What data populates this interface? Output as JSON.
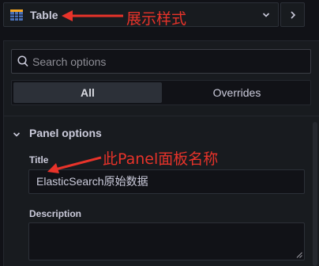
{
  "viz_picker": {
    "name": "Table",
    "icon": "table-icon"
  },
  "search": {
    "placeholder": "Search options",
    "value": ""
  },
  "tabs": [
    {
      "label": "All",
      "active": true
    },
    {
      "label": "Overrides",
      "active": false
    }
  ],
  "panel_options": {
    "title": "Panel options",
    "expanded": true,
    "fields": {
      "title_label": "Title",
      "title_value": "ElasticSearch原始数据",
      "description_label": "Description",
      "description_value": ""
    }
  },
  "annotations": {
    "viz_note": "展示样式",
    "title_note": "此Panel面板名称"
  },
  "colors": {
    "annotation": "#e8332a",
    "background": "#111217",
    "panel": "#181b1f",
    "table_icon": "#4a6fb5"
  }
}
